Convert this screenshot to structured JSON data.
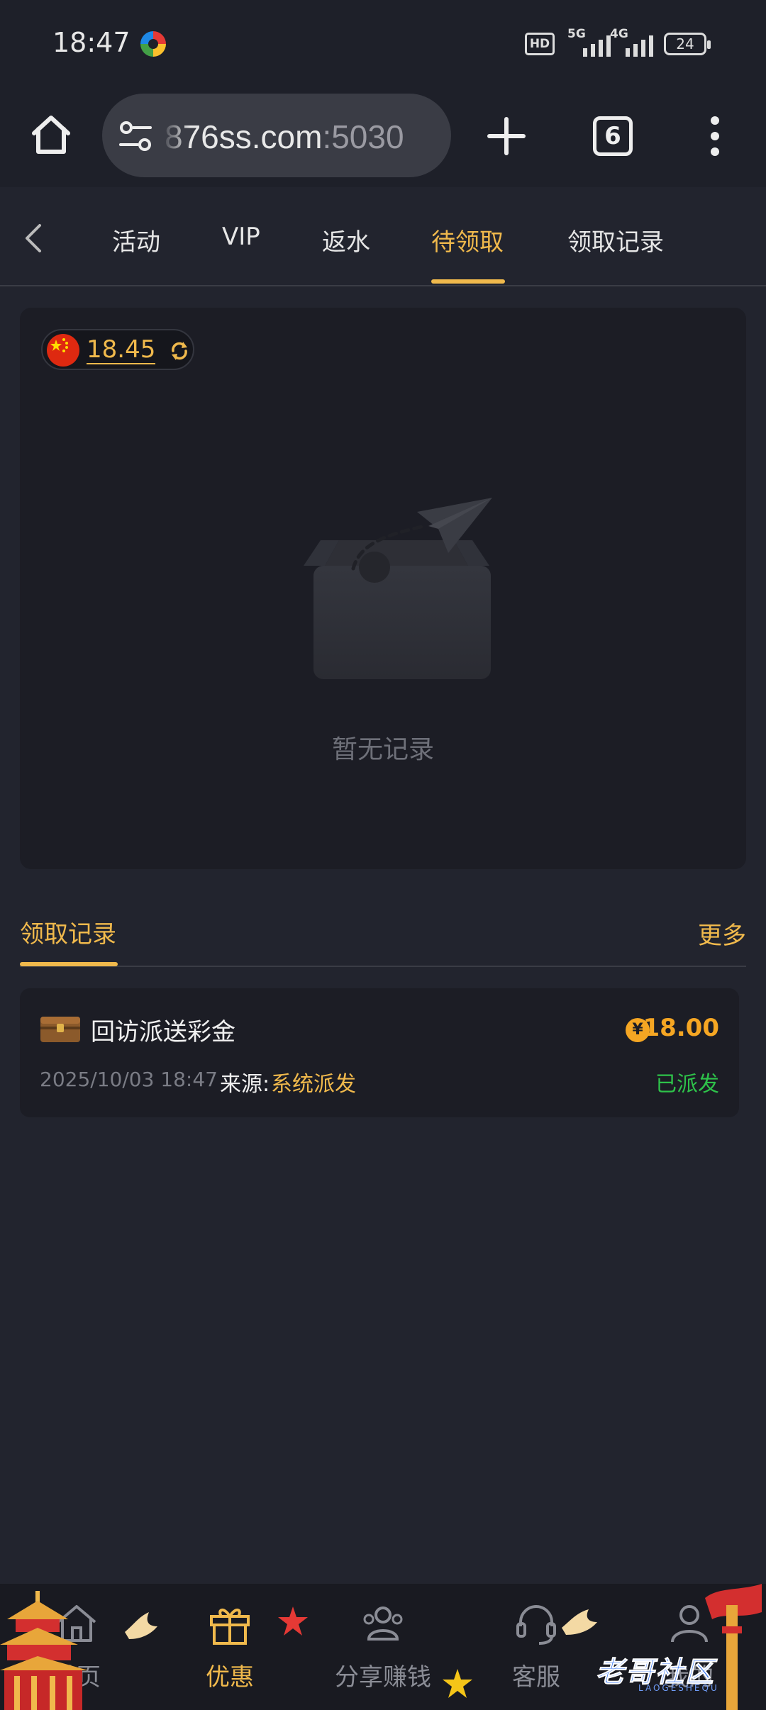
{
  "status_bar": {
    "time": "18:47",
    "hd_label": "HD",
    "signal_1": "5G",
    "signal_2": "4G",
    "battery": "24"
  },
  "browser": {
    "url_main": "876ss.com",
    "url_port": ":5030",
    "tab_count": "6"
  },
  "tabs": [
    {
      "label": "活动"
    },
    {
      "label": "VIP"
    },
    {
      "label": "返水"
    },
    {
      "label": "待领取",
      "active": true
    },
    {
      "label": "领取记录"
    }
  ],
  "balance": {
    "value": "18.45"
  },
  "empty_state": {
    "text": "暂无记录"
  },
  "records": {
    "title": "领取记录",
    "more": "更多",
    "items": [
      {
        "name": "回访派送彩金",
        "currency_symbol": "¥",
        "amount": "18.00",
        "date": "2025/10/03 18:47",
        "source_label": "来源:",
        "source": "系统派发",
        "status": "已派发"
      }
    ]
  },
  "bottom_nav": [
    {
      "label": "首页",
      "icon": "home-icon"
    },
    {
      "label": "优惠",
      "icon": "gift-icon",
      "active": true
    },
    {
      "label": "分享赚钱",
      "icon": "share-icon"
    },
    {
      "label": "客服",
      "icon": "headset-icon"
    },
    {
      "label": "我的",
      "icon": "user-icon"
    }
  ],
  "watermark": {
    "text": "老哥社区",
    "sub": "LAOGESHEQU"
  },
  "colors": {
    "accent": "#f0b94c",
    "background": "#22242e",
    "card": "#1c1d25",
    "success": "#2ec24a",
    "amount": "#f5a623"
  }
}
